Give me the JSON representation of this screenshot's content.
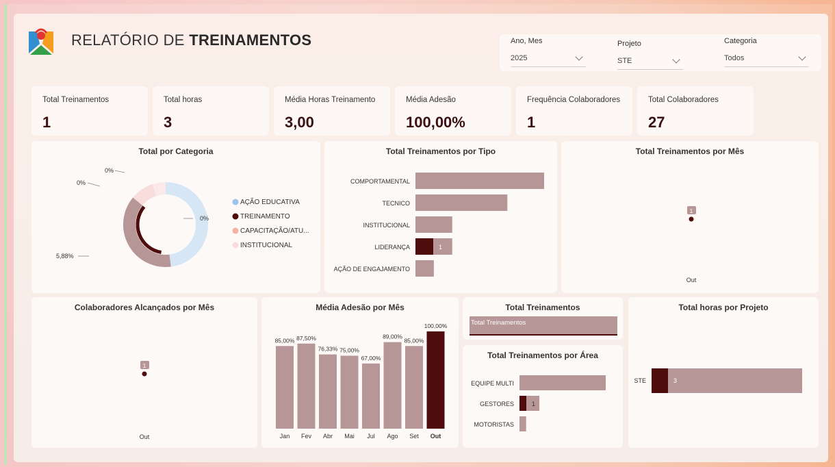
{
  "header": {
    "title_prefix": "RELATÓRIO DE",
    "title_bold": "TREINAMENTOS",
    "filters": [
      {
        "label": "Ano, Mes",
        "value": "2025"
      },
      {
        "label": "Projeto",
        "value": "STE"
      },
      {
        "label": "Categoria",
        "value": "Todos"
      }
    ]
  },
  "kpis": [
    {
      "label": "Total Treinamentos",
      "value": "1"
    },
    {
      "label": "Total horas",
      "value": "3"
    },
    {
      "label": "Média Horas Treinamento",
      "value": "3,00"
    },
    {
      "label": "Média Adesão",
      "value": "100,00%"
    },
    {
      "label": "Frequência Colaboradores",
      "value": "1"
    },
    {
      "label": "Total Colaboradores",
      "value": "27"
    }
  ],
  "colors": {
    "mauve": "#b69696",
    "dark": "#4e0c0c",
    "lightblue": "#d6e6f5",
    "salmon": "#f5b3a0",
    "pink": "#f9dcdc"
  },
  "chart_data": [
    {
      "type": "pie",
      "title": "Total por Categoria",
      "legend": [
        "AÇÃO EDUCATIVA",
        "TREINAMENTO",
        "CAPACITAÇÃO/ATU...",
        "INSTITUCIONAL"
      ],
      "legend_colors": [
        "#9cc3ea",
        "#4e0c0c",
        "#f5b3a0",
        "#f9dcdc"
      ],
      "slice_labels": [
        "0%",
        "5,88%",
        "0%",
        "0%"
      ]
    },
    {
      "type": "bar",
      "title": "Total Treinamentos por Tipo",
      "categories": [
        "COMPORTAMENTAL",
        "TECNICO",
        "INSTITUCIONAL",
        "LIDERANÇA",
        "AÇÃO DE ENGAJAMENTO"
      ],
      "values": [
        7,
        5,
        2,
        2,
        1
      ],
      "highlight": [
        0,
        0,
        0,
        1,
        0
      ],
      "highlight_label": "1"
    },
    {
      "type": "scatter",
      "title": "Total Treinamentos por Mês",
      "x": [
        "Out"
      ],
      "values": [
        1
      ],
      "data_label": "1"
    },
    {
      "type": "scatter",
      "title": "Colaboradores Alcançados por Mês",
      "x": [
        "Out"
      ],
      "values": [
        1
      ],
      "data_label": "1"
    },
    {
      "type": "bar",
      "title": "Média Adesão por Mês",
      "categories": [
        "Jan",
        "Fev",
        "Abr",
        "Mai",
        "Jul",
        "Ago",
        "Set",
        "Out"
      ],
      "values": [
        85.0,
        87.5,
        76.33,
        75.0,
        67.0,
        89.0,
        85.0,
        100.0
      ],
      "labels": [
        "85,00%",
        "87,50%",
        "76,33%",
        "75,00%",
        "67,00%",
        "89,00%",
        "85,00%",
        "100,00%"
      ],
      "ylim": [
        0,
        100
      ]
    },
    {
      "type": "bar",
      "title": "Total Treinamentos",
      "categories": [
        "Total Treinamentos"
      ],
      "values": [
        1
      ]
    },
    {
      "type": "bar",
      "title": "Total Treinamentos por Área",
      "categories": [
        "EQUIPE MULTI",
        "GESTORES",
        "MOTORISTAS"
      ],
      "values": [
        13,
        3,
        1
      ],
      "highlight_label": "1"
    },
    {
      "type": "bar",
      "title": "Total horas por Projeto",
      "categories": [
        "STE"
      ],
      "values": [
        26
      ],
      "highlight": [
        3
      ],
      "highlight_label": "3"
    }
  ]
}
